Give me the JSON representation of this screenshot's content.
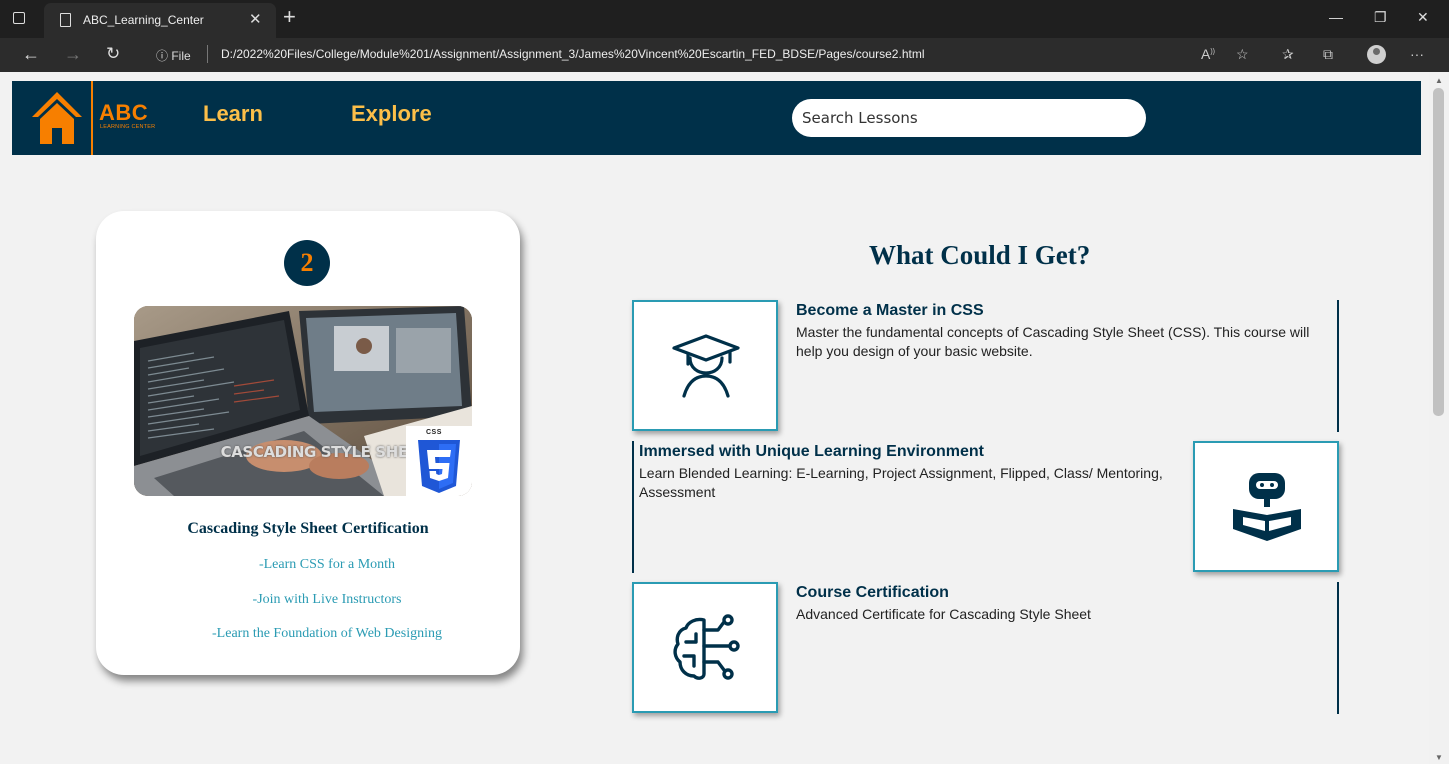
{
  "browser": {
    "tab_title": "ABC_Learning_Center",
    "url_prefix": "File",
    "url": "D:/2022%20Files/College/Module%201/Assignment/Assignment_3/James%20Vincent%20Escartin_FED_BDSE/Pages/course2.html"
  },
  "header": {
    "brand_name": "ABC",
    "brand_sub": "LEARNING CENTER",
    "nav_learn": "Learn",
    "nav_explore": "Explore",
    "search_placeholder": "Search Lessons"
  },
  "card": {
    "step": "2",
    "image_caption": "CASCADING STYLE SHEET",
    "image_badge": "CSS",
    "title": "Cascading Style Sheet Certification",
    "points": [
      "-Learn CSS for a Month",
      "-Join with Live Instructors",
      "-Learn the Foundation of Web Designing"
    ]
  },
  "features_section": {
    "title": "What Could I Get?",
    "items": [
      {
        "title": "Become a Master in CSS",
        "description": "Master the fundamental concepts of Cascading Style Sheet (CSS). This course will help you design of your basic website.",
        "icon": "graduate-icon"
      },
      {
        "title": "Immersed with Unique Learning Environment",
        "description": "Learn Blended Learning: E-Learning, Project Assignment, Flipped, Class/ Mentoring, Assessment",
        "icon": "robot-reading-icon"
      },
      {
        "title": "Course Certification",
        "description": "Advanced Certificate for Cascading Style Sheet",
        "icon": "ai-brain-icon"
      }
    ]
  },
  "colors": {
    "navy": "#003049",
    "orange": "#f77f00",
    "yellow": "#fcbf49",
    "teal": "#2a9bb3"
  }
}
